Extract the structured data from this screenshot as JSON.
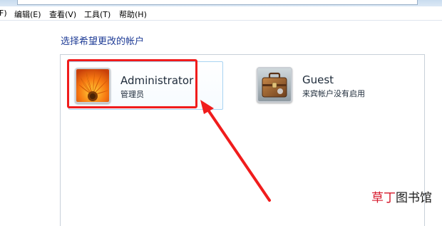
{
  "menu": {
    "file_fragment": "F)",
    "edit": "编辑(E)",
    "view": "查看(V)",
    "tools": "工具(T)",
    "help": "帮助(H)"
  },
  "page": {
    "heading": "选择希望更改的帐户"
  },
  "accounts": [
    {
      "name": "Administrator",
      "role": "管理员",
      "icon": "flower-user-picture-icon",
      "selected": true
    },
    {
      "name": "Guest",
      "role": "来宾帐户没有启用",
      "icon": "briefcase-user-picture-icon",
      "selected": false
    }
  ],
  "watermark": {
    "part1": "草丁",
    "part2": "图书馆"
  },
  "colors": {
    "heading": "#1f3c96",
    "highlight": "#f01c1c",
    "watermark_accent": "#d6192b"
  }
}
